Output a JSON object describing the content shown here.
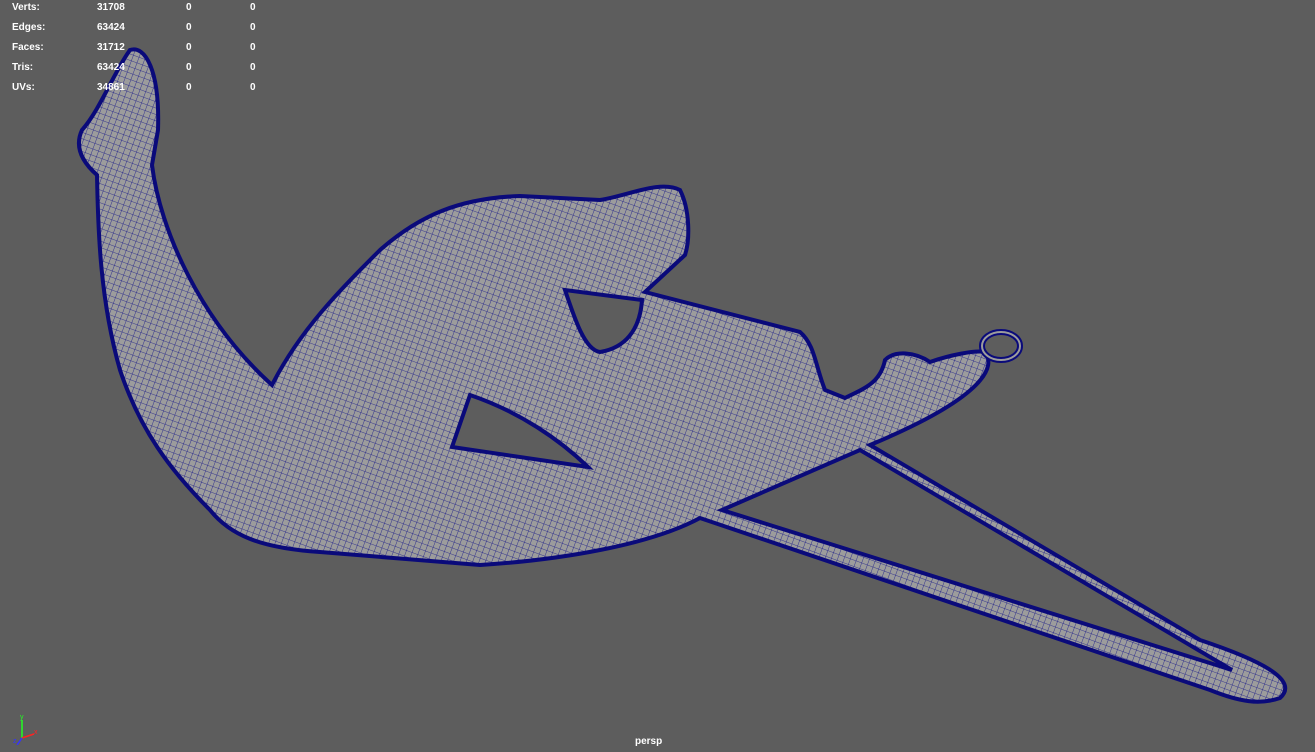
{
  "hud": {
    "rows": [
      {
        "label": "Verts:",
        "values": [
          "31708",
          "0",
          "0"
        ]
      },
      {
        "label": "Edges:",
        "values": [
          "63424",
          "0",
          "0"
        ]
      },
      {
        "label": "Faces:",
        "values": [
          "31712",
          "0",
          "0"
        ]
      },
      {
        "label": "Tris:",
        "values": [
          "63424",
          "0",
          "0"
        ]
      },
      {
        "label": "UVs:",
        "values": [
          "34861",
          "0",
          "0"
        ]
      }
    ]
  },
  "camera": {
    "name": "persp"
  },
  "axis": {
    "x": "x",
    "y": "y",
    "z": "z"
  },
  "colors": {
    "background": "#5d5d5d",
    "wire": "#0a0a7a",
    "surface": "#9c9c9c"
  }
}
